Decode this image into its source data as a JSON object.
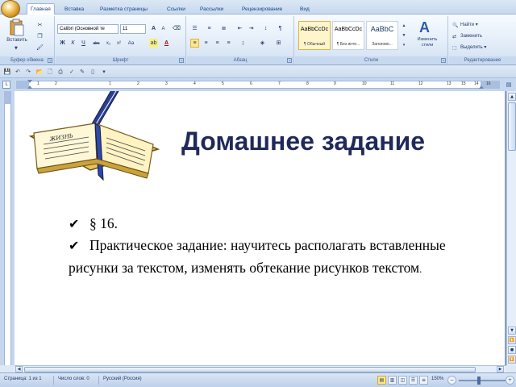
{
  "tabs": [
    "Главная",
    "Вставка",
    "Разметка страницы",
    "Ссылки",
    "Рассылки",
    "Рецензирование",
    "Вид"
  ],
  "ribbon": {
    "clipboard": {
      "paste_label": "Вставить",
      "group_label": "Буфер обмена"
    },
    "font": {
      "font_name": "Calibri (Основной те",
      "font_size": "11",
      "group_label": "Шрифт",
      "bold": "Ж",
      "italic": "К",
      "underline": "Ч",
      "strike": "abc",
      "subscript": "x₂",
      "superscript": "x²",
      "change_case": "Аа",
      "grow": "A",
      "shrink": "A",
      "font_color": "A"
    },
    "paragraph": {
      "group_label": "Абзац",
      "pilcrow": "¶"
    },
    "styles": {
      "group_label": "Стили",
      "items": [
        {
          "sample": "AaBbCcDc",
          "name": "¶ Обычный"
        },
        {
          "sample": "AaBbCcDc",
          "name": "¶ Без инте..."
        },
        {
          "sample": "AaBbC",
          "name": "Заголово..."
        }
      ],
      "change_styles": "Изменить стили"
    },
    "editing": {
      "group_label": "Редактирование",
      "find": "Найти",
      "replace": "Заменить",
      "select": "Выделить"
    }
  },
  "ruler": {
    "numbers": [
      "1",
      "2",
      "1",
      "2",
      "3",
      "4",
      "5",
      "6",
      "7",
      "8",
      "9",
      "10",
      "11",
      "12",
      "13",
      "14",
      "15",
      "16"
    ]
  },
  "document": {
    "title": "Домашнее задание",
    "bullet1": "§ 16.",
    "bullet2": "Практическое задание: научитесь располагать вставленные рисунки за текстом, изменять обтекание рисунков текстом",
    "trailing_dot": ".",
    "book_caption": "ЖИЗНЬ"
  },
  "status": {
    "page": "Страница: 1 из 1",
    "words": "Число слов: 0",
    "language": "Русский (Россия)",
    "zoom": "150%"
  },
  "colors": {
    "title": "#1f2a5a",
    "ribbon_text": "#15428b"
  }
}
